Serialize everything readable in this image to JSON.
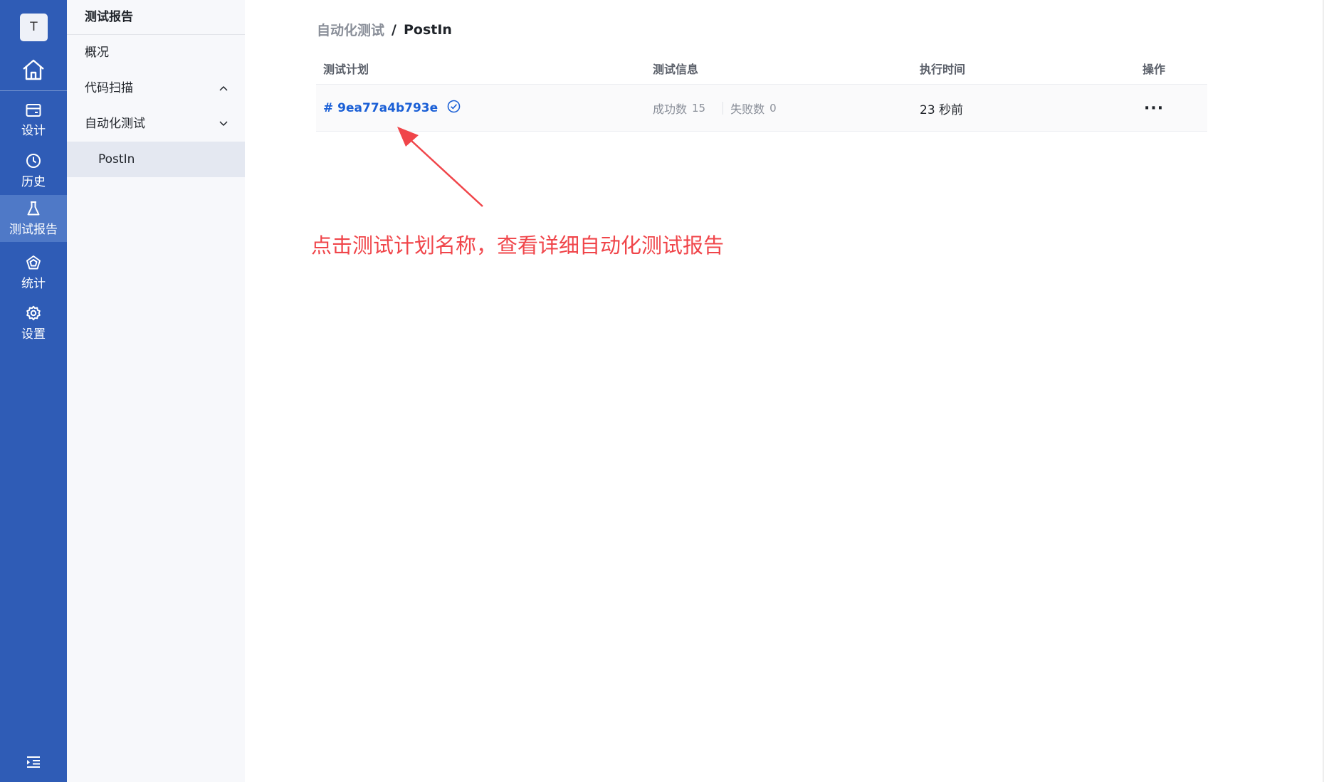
{
  "rail": {
    "avatar": "T",
    "items": [
      {
        "label": "设计",
        "icon": "card-icon"
      },
      {
        "label": "历史",
        "icon": "clock-icon"
      },
      {
        "label": "测试报告",
        "icon": "flask-icon"
      },
      {
        "label": "统计",
        "icon": "pentagon-icon"
      },
      {
        "label": "设置",
        "icon": "gear-icon"
      }
    ]
  },
  "subnav": {
    "title": "测试报告",
    "items": [
      {
        "label": "概况"
      },
      {
        "label": "代码扫描"
      },
      {
        "label": "自动化测试"
      },
      {
        "label": "PostIn"
      }
    ]
  },
  "breadcrumb": {
    "parent": "自动化测试",
    "separator": "/",
    "current": "PostIn"
  },
  "table": {
    "headers": {
      "plan": "测试计划",
      "info": "测试信息",
      "time": "执行时间",
      "action": "操作"
    },
    "rows": [
      {
        "plan": "# 9ea77a4b793e",
        "success_label": "成功数",
        "success_count": "15",
        "fail_label": "失败数",
        "fail_count": "0",
        "time": "23 秒前",
        "action": "···"
      }
    ]
  },
  "annotation": {
    "text": "点击测试计划名称，查看详细自动化测试报告",
    "color": "#f0454a"
  },
  "colors": {
    "rail": "#2f5cb6",
    "rail_active": "#4f79c7",
    "link": "#1a5fd6"
  }
}
